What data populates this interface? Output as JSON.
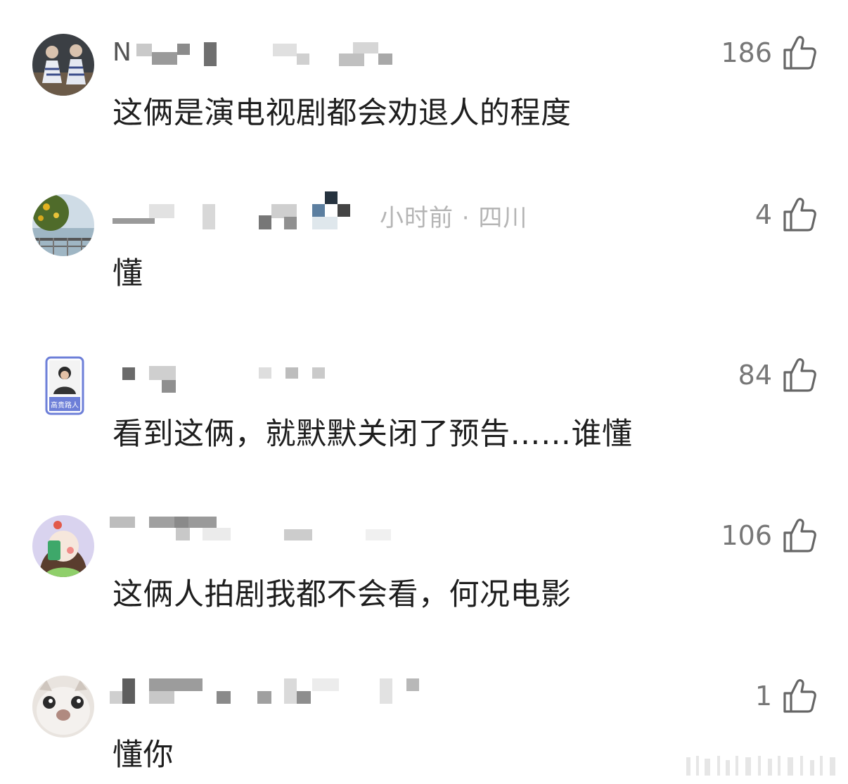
{
  "comments": [
    {
      "name_prefix": "N",
      "meta": "",
      "text": "这俩是演电视剧都会劝退人的程度",
      "likes": "186",
      "avatar_icon": "avatar-two-women-icon"
    },
    {
      "name_prefix": "",
      "meta": "小时前 · 四川",
      "text": "懂",
      "likes": "4",
      "avatar_icon": "avatar-tree-lake-icon"
    },
    {
      "name_prefix": "",
      "meta": "",
      "text": "看到这俩，就默默关闭了预告……谁懂",
      "likes": "84",
      "avatar_icon": "avatar-badge-person-icon"
    },
    {
      "name_prefix": "",
      "meta": "",
      "text": "这俩人拍剧我都不会看，何况电影",
      "likes": "106",
      "avatar_icon": "avatar-cartoon-girl-icon"
    },
    {
      "name_prefix": "",
      "meta": "",
      "text": "懂你",
      "likes": "1",
      "avatar_icon": "avatar-cat-face-icon"
    }
  ],
  "avatar3_badge_text": "高贵路人",
  "colors": {
    "meta": "#b5b5b5",
    "likes": "#777777",
    "text": "#1e1e1e"
  }
}
